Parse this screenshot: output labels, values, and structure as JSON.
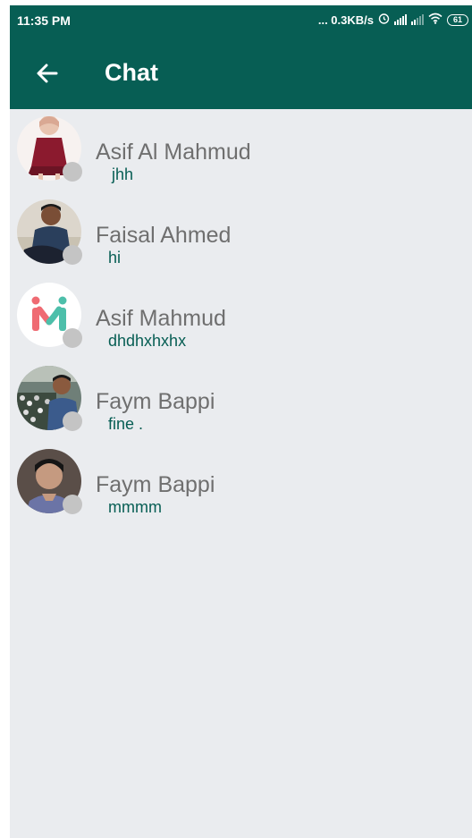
{
  "status_bar": {
    "time": "11:35 PM",
    "network_speed": "... 0.3KB/s",
    "battery_level": "61",
    "icons": [
      "alarm-icon",
      "signal-icon",
      "signal-icon",
      "wifi-icon",
      "battery-icon"
    ]
  },
  "app_bar": {
    "back_icon": "arrow-left-icon",
    "title": "Chat"
  },
  "colors": {
    "primary": "#075e54",
    "background": "#eaecef",
    "name_text": "#6f6f6f",
    "message_text": "#075e54",
    "status_dot": "#c4c4c4"
  },
  "chats": [
    {
      "name": "Asif Al Mahmud",
      "last_message": "jhh",
      "avatar": "girl-red-dress-photo"
    },
    {
      "name": "Faisal Ahmed",
      "last_message": "hi",
      "avatar": "man-sitting-photo"
    },
    {
      "name": "Asif Mahmud",
      "last_message": "dhdhxhxhx",
      "avatar": "m-logo"
    },
    {
      "name": "Faym Bappi",
      "last_message": "fine .",
      "avatar": "man-crowd-photo"
    },
    {
      "name": "Faym Bappi",
      "last_message": "mmmm",
      "avatar": "man-portrait-photo"
    }
  ]
}
